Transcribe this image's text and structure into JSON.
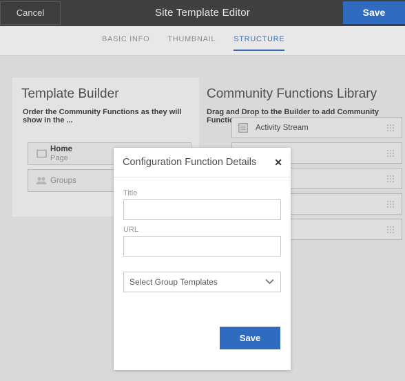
{
  "topbar": {
    "cancel_label": "Cancel",
    "title": "Site Template Editor",
    "save_label": "Save",
    "accent_color": "#2f6cc0",
    "background_color": "#404040"
  },
  "tabs": [
    {
      "label": "BASIC INFO",
      "active": false
    },
    {
      "label": "THUMBNAIL",
      "active": false
    },
    {
      "label": "STRUCTURE",
      "active": true
    }
  ],
  "builder": {
    "title": "Template Builder",
    "subtitle": "Order the Community Functions as they will show in the ...",
    "rows": [
      {
        "icon": "page-icon",
        "main": "Home",
        "sub": "Page"
      },
      {
        "icon": "groups-icon",
        "main": "",
        "sub": "Groups"
      }
    ]
  },
  "library": {
    "title": "Community Functions Library",
    "subtitle": "Drag and Drop to the Builder to add Community Functions",
    "rows": [
      {
        "icon": "list-icon",
        "label": "Activity Stream"
      },
      {
        "icon": "list-icon",
        "label": ""
      },
      {
        "icon": "list-icon",
        "label": ""
      },
      {
        "icon": "list-icon",
        "label": ""
      },
      {
        "icon": "list-icon",
        "label": ""
      }
    ]
  },
  "dialog": {
    "title": "Configuration Function Details",
    "close_label": "✕",
    "title_field": {
      "label": "Title",
      "value": "",
      "placeholder": ""
    },
    "url_field": {
      "label": "URL",
      "value": "",
      "placeholder": ""
    },
    "group_select": {
      "label": "Select Group Templates"
    },
    "save_label": "Save",
    "accent_color": "#2f6cc0"
  }
}
